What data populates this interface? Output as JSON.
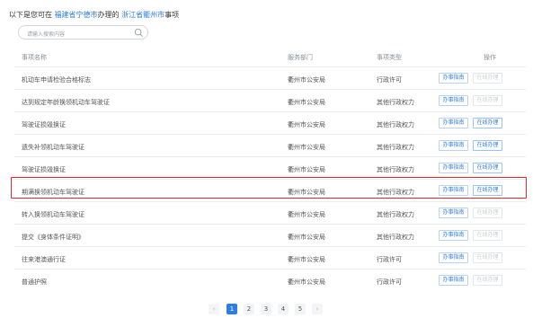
{
  "heading": {
    "prefix": "以下是您可在",
    "location_from": "福建省宁德市",
    "middle": "办理的",
    "location_to": "浙江省衢州市",
    "suffix": "事项"
  },
  "search": {
    "placeholder": "请输入搜索内容",
    "icon": "search-icon"
  },
  "table": {
    "columns": [
      "事项名称",
      "服务部门",
      "事项类型",
      "操作"
    ],
    "guide_label": "办事指南",
    "online_label": "在线办理",
    "rows": [
      {
        "name": "机动车申请检验合格标志",
        "dept": "衢州市公安局",
        "type": "行政许可",
        "online_enabled": false
      },
      {
        "name": "达到规定年龄换领机动车驾驶证",
        "dept": "衢州市公安局",
        "type": "其他行政权力",
        "online_enabled": false
      },
      {
        "name": "驾驶证损毁换证",
        "dept": "衢州市公安局",
        "type": "其他行政权力",
        "online_enabled": true
      },
      {
        "name": "遗失补领机动车驾驶证",
        "dept": "衢州市公安局",
        "type": "其他行政权力",
        "online_enabled": true
      },
      {
        "name": "驾驶证损毁换证",
        "dept": "衢州市公安局",
        "type": "其他行政权力",
        "online_enabled": true
      },
      {
        "name": "期满换领机动车驾驶证",
        "dept": "衢州市公安局",
        "type": "其他行政权力",
        "online_enabled": true,
        "highlighted": true
      },
      {
        "name": "转入换领机动车驾驶证",
        "dept": "衢州市公安局",
        "type": "其他行政权力",
        "online_enabled": false
      },
      {
        "name": "提交《身体条件证明》",
        "dept": "衢州市公安局",
        "type": "其他行政权力",
        "online_enabled": false
      },
      {
        "name": "往来港澳通行证",
        "dept": "衢州市公安局",
        "type": "行政许可",
        "online_enabled": false
      },
      {
        "name": "普通护照",
        "dept": "衢州市公安局",
        "type": "行政许可",
        "online_enabled": false
      }
    ]
  },
  "pagination": {
    "prev": "‹",
    "pages": [
      "1",
      "2",
      "3",
      "4",
      "5"
    ],
    "current": "1",
    "next": "›"
  },
  "colors": {
    "accent": "#2f7de1",
    "highlight_border": "#e0282b"
  }
}
